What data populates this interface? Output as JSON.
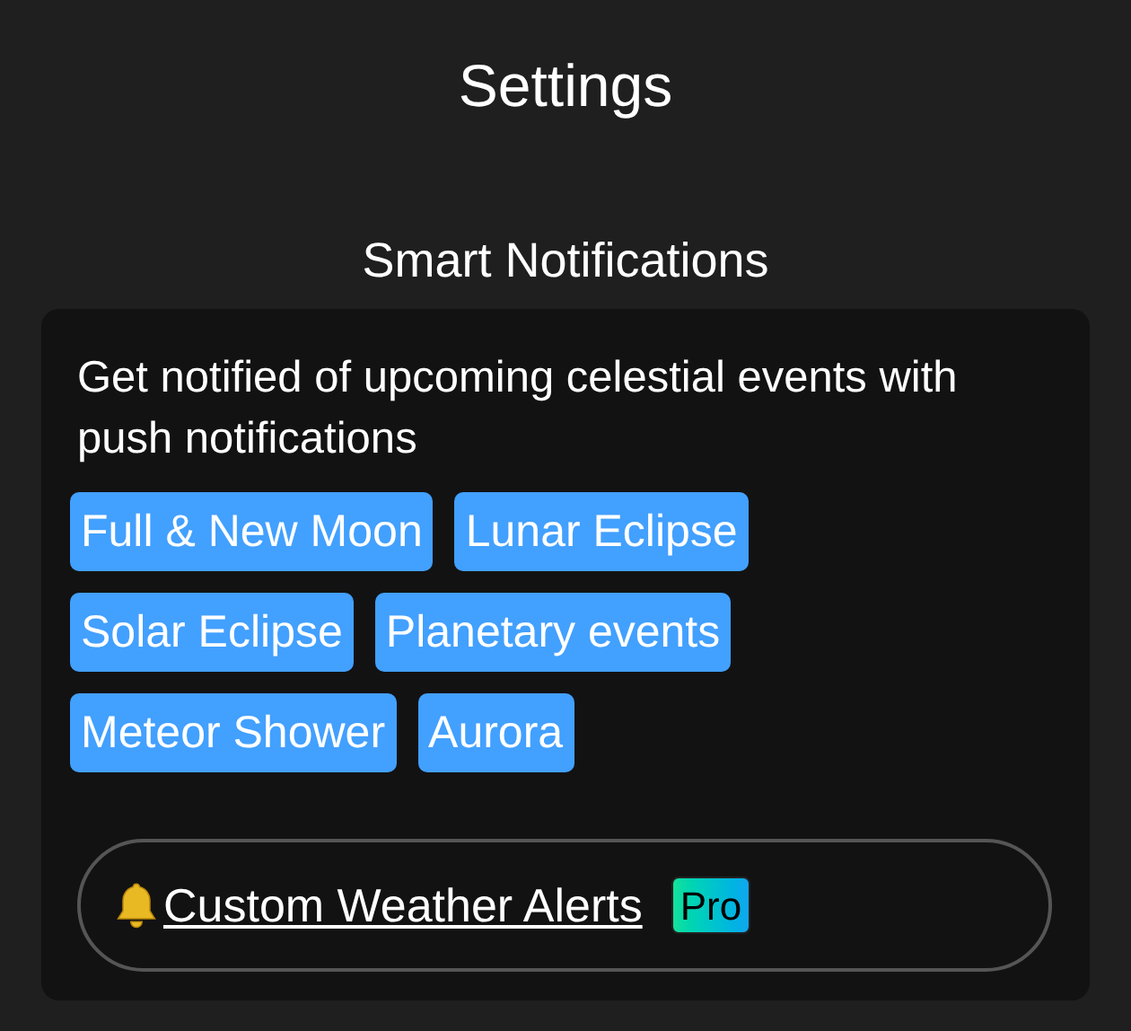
{
  "title": "Settings",
  "section": {
    "title": "Smart Notifications",
    "description": "Get notified of upcoming celestial events with push notifications",
    "tags": [
      "Full & New Moon",
      "Lunar Eclipse",
      "Solar Eclipse",
      "Planetary events",
      "Meteor Shower",
      "Aurora"
    ],
    "alert_link": {
      "label": "Custom Weather Alerts",
      "badge": "Pro"
    }
  }
}
